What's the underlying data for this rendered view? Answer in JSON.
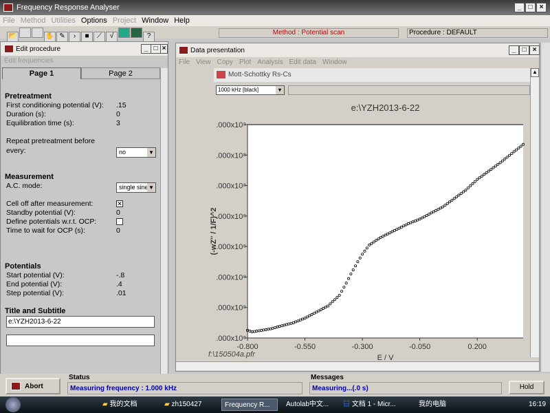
{
  "app": {
    "title": "Frequency Response Analyser",
    "menu": [
      "File",
      "Method",
      "Utilities",
      "Options",
      "Project",
      "Window",
      "Help"
    ],
    "menu_enabled": [
      false,
      false,
      false,
      true,
      false,
      true,
      true
    ],
    "method": "Method : Potential scan",
    "procedure": "Procedure : DEFAULT"
  },
  "procedure": {
    "title": "Edit procedure",
    "submenu": "Edit frequencies",
    "tabs": [
      "Page 1",
      "Page 2"
    ],
    "pretreatment": {
      "heading": "Pretreatment",
      "first_label": "First conditioning potential (V):",
      "first_value": ".15",
      "duration_label": "Duration (s):",
      "duration_value": "0",
      "equil_label": "Equilibration time (s):",
      "equil_value": "3",
      "repeat_label1": "Repeat pretreatment before",
      "repeat_label2": "every:",
      "repeat_value": "no"
    },
    "measurement": {
      "heading": "Measurement",
      "ac_label": "A.C. mode:",
      "ac_value": "single sine",
      "celloff_label": "Cell off after measurement:",
      "celloff_checked": true,
      "standby_label": "Standby potential (V):",
      "standby_value": "0",
      "ocp_label": "Define potentials w.r.t. OCP:",
      "ocp_checked": false,
      "wait_label": "Time to wait for OCP (s):",
      "wait_value": "0"
    },
    "potentials": {
      "heading": "Potentials",
      "start_label": "Start potential (V):",
      "start_value": "-.8",
      "end_label": "End potential (V):",
      "end_value": ".4",
      "step_label": "Step potential (V):",
      "step_value": ".01"
    },
    "title_sub": {
      "heading": "Title and Subtitle",
      "title_value": "e:\\YZH2013-6-22",
      "subtitle_value": ""
    }
  },
  "data_window": {
    "title": "Data presentation",
    "menu": [
      "File",
      "View",
      "Copy",
      "Plot",
      "Analysis",
      "Edit data",
      "Window"
    ],
    "plot_name": "Mott-Schottky Rs-Cs",
    "freq_select": "1000 kHz   [black]",
    "file_label": "f:\\150504a.pfr"
  },
  "chart_data": {
    "type": "scatter",
    "title": "e:\\YZH2013-6-22",
    "xlabel": "E / V",
    "ylabel": "(-wZ'' / 1/F)^2",
    "xlim": [
      -0.8,
      0.4
    ],
    "ylim": [
      0,
      7
    ],
    "x_ticks": [
      "-0.800",
      "-0.550",
      "-0.300",
      "-0.050",
      "0.200"
    ],
    "x_tick_values": [
      -0.8,
      -0.55,
      -0.3,
      -0.05,
      0.2
    ],
    "y_ticks": [
      ".000x10⁸",
      ".000x10⁸",
      ".000x10⁸",
      ".000x10⁸",
      ".000x10⁸",
      ".000x10⁸",
      ".000x10⁸",
      ".000x10⁸"
    ],
    "curve": [
      [
        -0.8,
        0.25
      ],
      [
        -0.78,
        0.2
      ],
      [
        -0.7,
        0.3
      ],
      [
        -0.6,
        0.5
      ],
      [
        -0.55,
        0.65
      ],
      [
        -0.45,
        1.05
      ],
      [
        -0.4,
        1.4
      ],
      [
        -0.37,
        1.8
      ],
      [
        -0.35,
        2.1
      ],
      [
        -0.32,
        2.5
      ],
      [
        -0.3,
        2.75
      ],
      [
        -0.27,
        3.05
      ],
      [
        -0.22,
        3.3
      ],
      [
        -0.1,
        3.75
      ],
      [
        -0.05,
        3.9
      ],
      [
        0.05,
        4.3
      ],
      [
        0.15,
        4.85
      ],
      [
        0.2,
        5.2
      ],
      [
        0.3,
        5.75
      ],
      [
        0.4,
        6.35
      ]
    ],
    "marker": "open-circle",
    "color": "#000000"
  },
  "status": {
    "abort": "Abort",
    "status_label": "Status",
    "status_text": "Measuring frequency : 1.000 kHz",
    "messages_label": "Messages",
    "messages_text": "Measuring...(.0 s)",
    "hold": "Hold"
  },
  "taskbar": {
    "items": [
      "我的文档",
      "zh150427",
      "Frequency R...",
      "Autolab中文...",
      "文档 1 - Micr...",
      "我的电脑"
    ],
    "clock": "16:19"
  }
}
